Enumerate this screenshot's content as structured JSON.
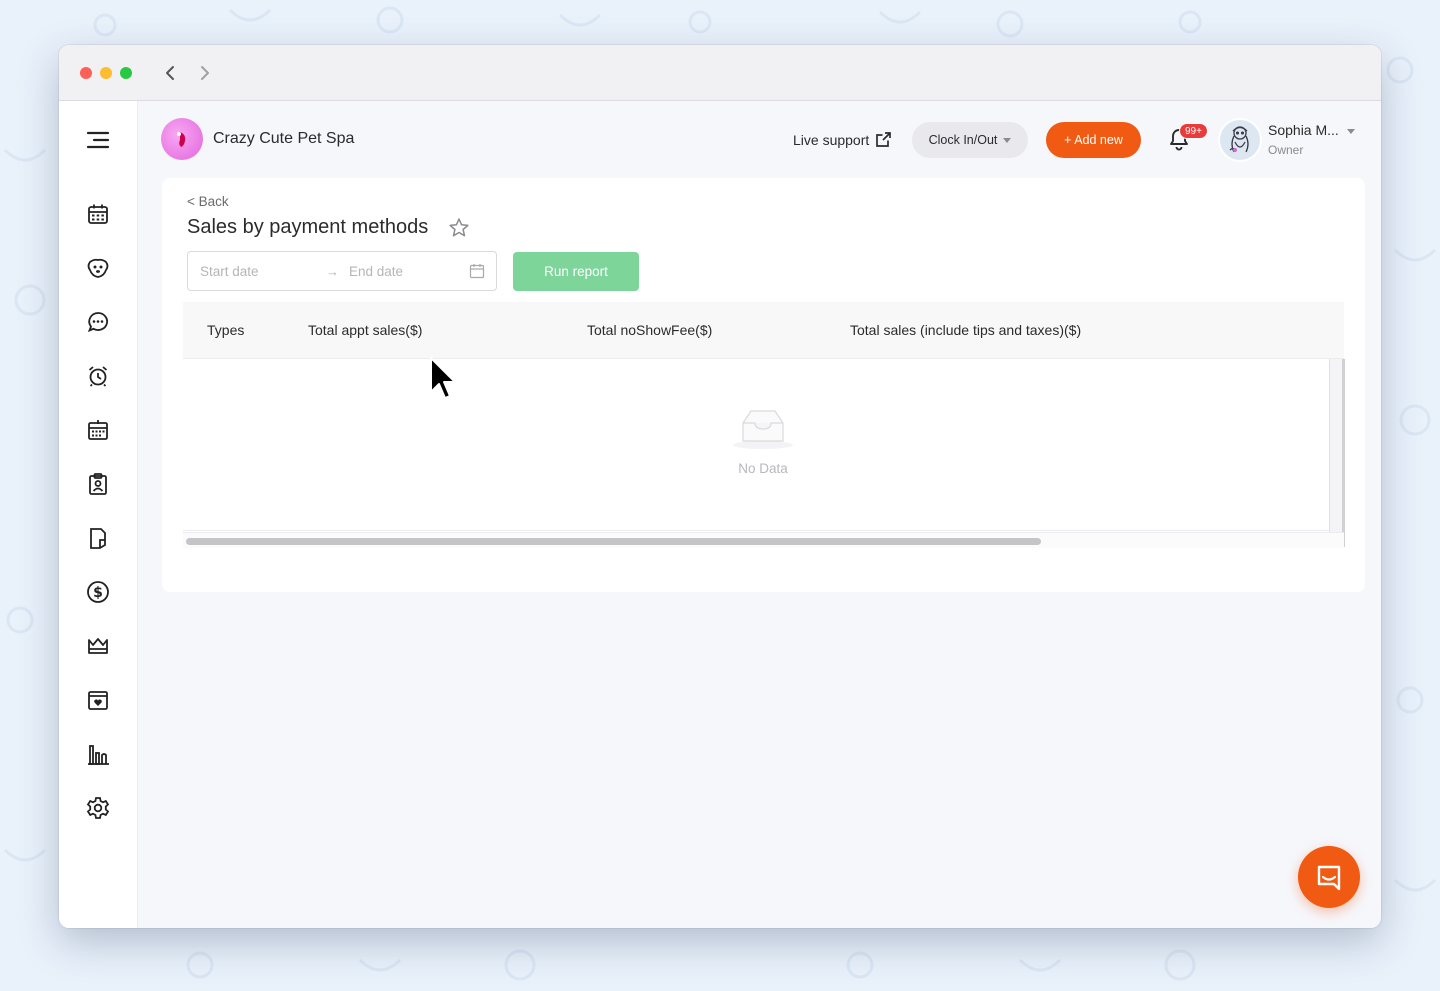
{
  "app": {
    "business_name": "Crazy Cute Pet Spa"
  },
  "header": {
    "live_support": "Live support",
    "clock_label": "Clock In/Out",
    "add_new": "+ Add new",
    "notification_badge": "99+",
    "user_name": "Sophia M...",
    "user_role": "Owner"
  },
  "page": {
    "back": "< Back",
    "title": "Sales by payment methods"
  },
  "filters": {
    "start_placeholder": "Start date",
    "arrow": "→",
    "end_placeholder": "End date",
    "run_label": "Run report"
  },
  "table": {
    "columns": [
      "Types",
      "Total appt sales($)",
      "Total noShowFee($)",
      "Total sales (include tips and taxes)($)"
    ],
    "empty_text": "No Data",
    "horizontal_scroll_fraction": 0.74
  },
  "sidebar": {
    "items": [
      "menu-icon",
      "calendar-icon",
      "pet-icon",
      "chat-icon",
      "alarm-icon",
      "schedule-icon",
      "clipboard-icon",
      "tag-icon",
      "dollar-icon",
      "crown-icon",
      "calendar-heart-icon",
      "bar-chart-icon",
      "settings-icon"
    ]
  },
  "colors": {
    "accent": "#f15a12",
    "run_button": "#7ed59a",
    "badge": "#e93b3b",
    "logo": "#e365dd"
  }
}
